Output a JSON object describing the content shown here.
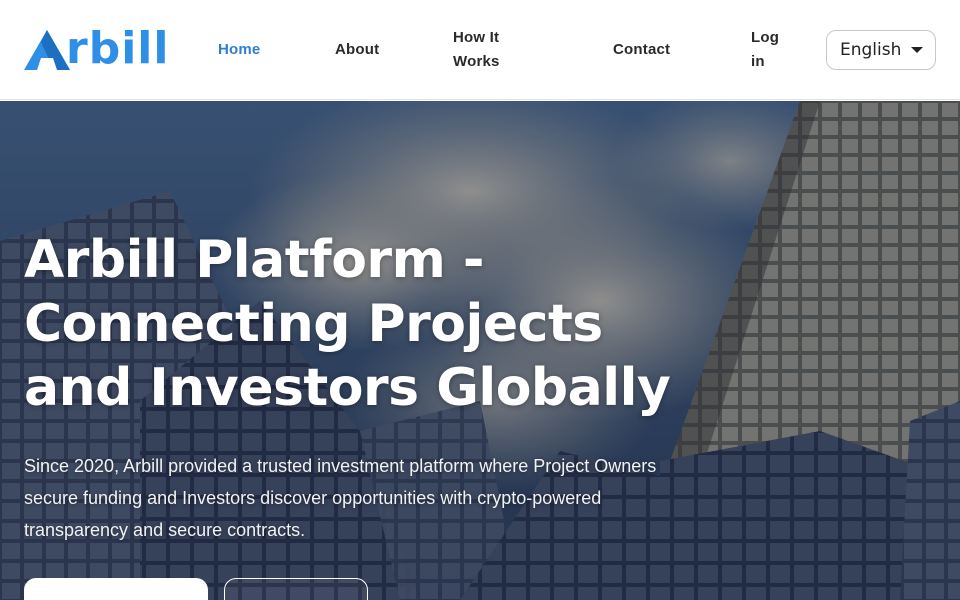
{
  "brand": {
    "name": "Arbill",
    "accent": "#2f8fe6"
  },
  "nav": {
    "home": "Home",
    "about": "About",
    "how_it_works_line1": "How It",
    "how_it_works_line2": "Works",
    "contact": "Contact",
    "login_line1": "Log",
    "login_line2": "in",
    "active_color": "#2f7fd0"
  },
  "language": {
    "selected": "English",
    "icon": "caret-down-icon"
  },
  "hero": {
    "title": "Arbill Platform - Connecting Projects and Investors Globally",
    "subtitle": "Since 2020, Arbill provided a trusted investment platform where Project Owners secure funding and Investors discover opportunities with crypto-powered transparency and secure contracts.",
    "background": "glass-skyscrapers-sky-photo"
  }
}
